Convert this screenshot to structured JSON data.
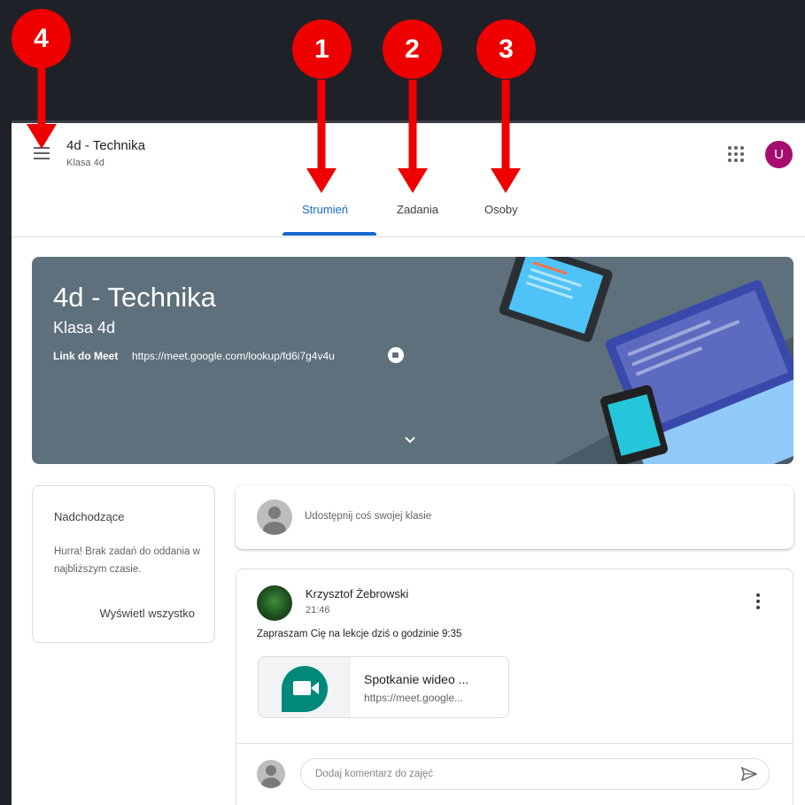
{
  "header": {
    "class_title": "4d - Technika",
    "class_subtitle": "Klasa 4d",
    "avatar_letter": "U",
    "tabs": [
      {
        "label": "Strumień"
      },
      {
        "label": "Zadania"
      },
      {
        "label": "Osoby"
      }
    ]
  },
  "banner": {
    "title": "4d - Technika",
    "subtitle": "Klasa 4d",
    "meet_label": "Link do Meet",
    "meet_link": "https://meet.google.com/lookup/fd6i7g4v4u"
  },
  "upcoming": {
    "title": "Nadchodzące",
    "text": "Hurra! Brak zadań do oddania w najbliższym czasie.",
    "link": "Wyświetl wszystko"
  },
  "share": {
    "placeholder": "Udostępnij coś swojej klasie"
  },
  "post": {
    "author": "Krzysztof Żebrowski",
    "time": "21:46",
    "body": "Zapraszam Cię na lekcje dziś o godzinie 9:35",
    "attachment_title": "Spotkanie wideo ...",
    "attachment_url": "https://meet.google...",
    "comment_placeholder": "Dodaj komentarz do zajęć"
  },
  "markers": [
    {
      "number": "1"
    },
    {
      "number": "2"
    },
    {
      "number": "3"
    },
    {
      "number": "4"
    }
  ],
  "colors": {
    "accent": "#1967d2",
    "marker": "#ee0000",
    "banner": "#5e707c",
    "avatar": "#a50e6e"
  }
}
